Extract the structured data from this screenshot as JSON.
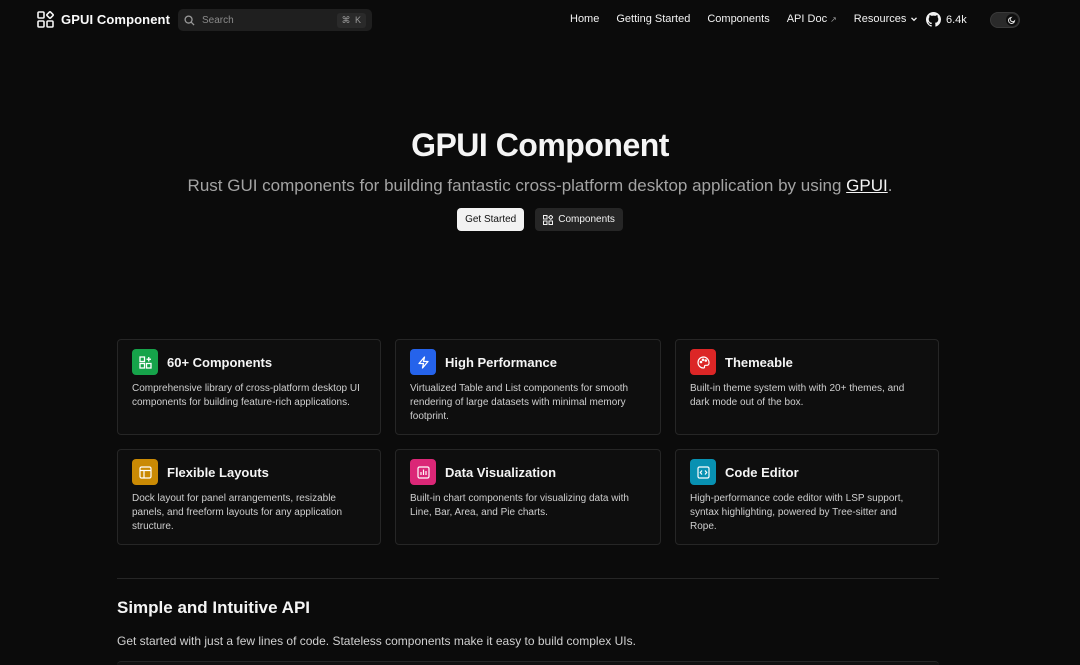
{
  "header": {
    "brand": "GPUI Component",
    "search": {
      "placeholder": "Search",
      "shortcut": "⌘ K"
    },
    "nav": [
      {
        "label": "Home"
      },
      {
        "label": "Getting Started"
      },
      {
        "label": "Components"
      },
      {
        "label": "API Doc",
        "external": "↗"
      },
      {
        "label": "Resources"
      }
    ],
    "github": {
      "stars": "6.4k"
    }
  },
  "hero": {
    "title": "GPUI Component",
    "subtitle_before": "Rust GUI components for building fantastic cross-platform desktop application by using ",
    "subtitle_link": "GPUI",
    "subtitle_after": ".",
    "primary_button": "Get Started",
    "secondary_button": "Components"
  },
  "features": [
    {
      "icon": "grid-plus-icon",
      "color": "#16a34a",
      "title": "60+ Components",
      "desc": "Comprehensive library of cross-platform desktop UI components for building feature-rich applications."
    },
    {
      "icon": "lightning-icon",
      "color": "#2563eb",
      "title": "High Performance",
      "desc": "Virtualized Table and List components for smooth rendering of large datasets with minimal memory footprint."
    },
    {
      "icon": "palette-icon",
      "color": "#dc2626",
      "title": "Themeable",
      "desc": "Built-in theme system with with 20+ themes, and dark mode out of the box."
    },
    {
      "icon": "layout-icon",
      "color": "#ca8a04",
      "title": "Flexible Layouts",
      "desc": "Dock layout for panel arrangements, resizable panels, and freeform layouts for any application structure."
    },
    {
      "icon": "chart-icon",
      "color": "#db2777",
      "title": "Data Visualization",
      "desc": "Built-in chart components for visualizing data with Line, Bar, Area, and Pie charts."
    },
    {
      "icon": "code-icon",
      "color": "#0891b2",
      "title": "Code Editor",
      "desc": "High-performance code editor with LSP support, syntax highlighting, powered by Tree-sitter and Rope."
    }
  ],
  "section": {
    "title": "Simple and Intuitive API",
    "desc": "Get started with just a few lines of code. Stateless components make it easy to build complex UIs."
  }
}
